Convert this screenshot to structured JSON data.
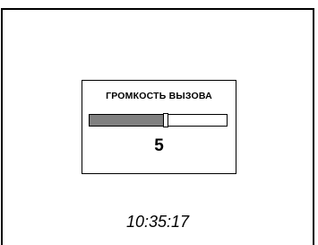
{
  "dialog": {
    "title": "ГРОМКОСТЬ ВЫЗОВА",
    "value": "5",
    "level_fraction": 0.55
  },
  "clock": {
    "time": "10:35:17"
  },
  "colors": {
    "fill": "#808080",
    "border": "#000000",
    "background": "#ffffff"
  }
}
